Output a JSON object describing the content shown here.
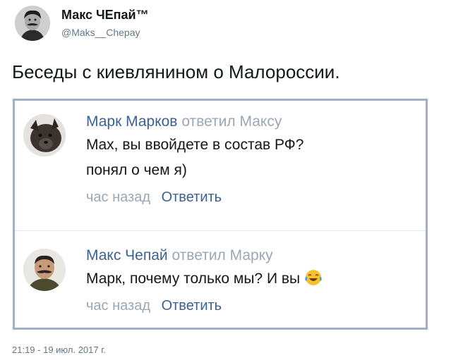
{
  "tweet": {
    "author_name": "Макс ЧЕпай™",
    "author_handle": "@Maks__Chepay",
    "text": "Беседы с киевлянином о Малороссии.",
    "timestamp": "21:19 - 19 июл. 2017 г."
  },
  "comments": [
    {
      "author": "Марк Марков",
      "replied": "ответил Максу",
      "lines": [
        "Max, вы ввойдете в состав РФ?",
        "понял о чем я)"
      ],
      "time": "час назад",
      "reply_label": "Ответить",
      "avatar_icon": "dog-avatar"
    },
    {
      "author": "Макс Чепай",
      "replied": "ответил Марку",
      "lines": [
        "Марк, почему только мы? И вы"
      ],
      "time": "час назад",
      "reply_label": "Ответить",
      "avatar_icon": "mustache-man-avatar",
      "emoji_icon": "tears-of-joy-emoji"
    }
  ],
  "colors": {
    "link": "#3b6193",
    "muted": "#9aa7b5",
    "embed_border": "#9fb1c9",
    "handle": "#657786"
  }
}
